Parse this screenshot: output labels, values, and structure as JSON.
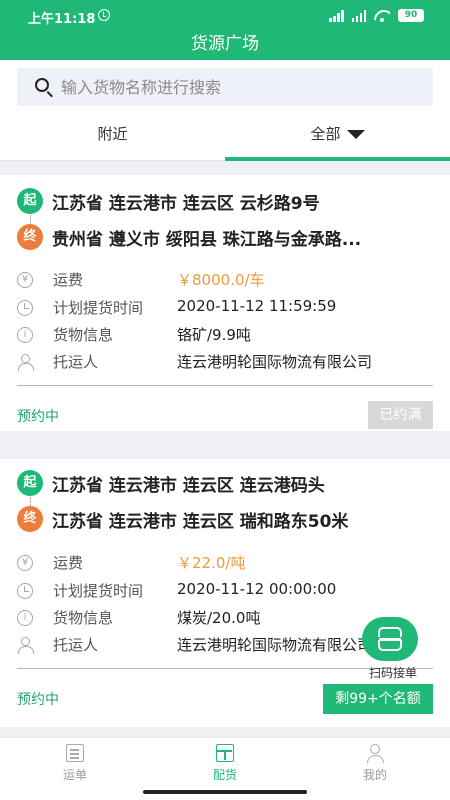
{
  "status_bar": {
    "time": "上午11:18",
    "battery": "90"
  },
  "header": {
    "title": "货源广场"
  },
  "search": {
    "placeholder": "输入货物名称进行搜索"
  },
  "tabs": [
    {
      "label": "附近",
      "active": false
    },
    {
      "label": "全部",
      "active": true
    }
  ],
  "labels": {
    "start_badge": "起",
    "end_badge": "终",
    "freight": "运费",
    "pickup_time": "计划提货时间",
    "cargo_info": "货物信息",
    "shipper": "托运人"
  },
  "orders": [
    {
      "origin": "江苏省 连云港市 连云区 云杉路9号",
      "destination": "贵州省 遵义市 绥阳县 珠江路与金承路...",
      "freight": "￥8000.0/车",
      "pickup_time": "2020-11-12 11:59:59",
      "cargo": "铬矿/9.9吨",
      "shipper": "连云港明轮国际物流有限公司",
      "status": "预约中",
      "action": "已约满"
    },
    {
      "origin": "江苏省 连云港市 连云区 连云港码头",
      "destination": "江苏省 连云港市 连云区 瑞和路东50米",
      "freight": "￥22.0/吨",
      "pickup_time": "2020-11-12 00:00:00",
      "cargo": "煤炭/20.0吨",
      "shipper": "连云港明轮国际物流有限公司",
      "status": "预约中",
      "action": "剩99+个名额"
    }
  ],
  "scan": {
    "label": "扫码接单"
  },
  "bottom_nav": [
    {
      "label": "运单",
      "icon": "document-icon",
      "active": false
    },
    {
      "label": "配货",
      "icon": "box-icon",
      "active": true
    },
    {
      "label": "我的",
      "icon": "person-icon",
      "active": false
    }
  ],
  "colors": {
    "primary": "#20b877",
    "accent": "#ee7c3a",
    "price": "#ee9a3a"
  }
}
